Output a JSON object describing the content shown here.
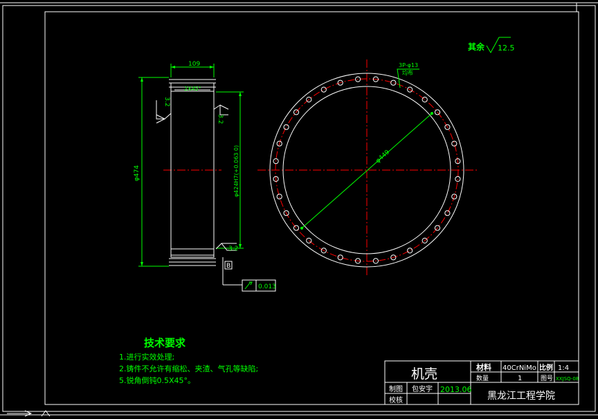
{
  "roughness": {
    "label": "其余",
    "value": "12.5"
  },
  "side_view": {
    "width_dim": "109",
    "chamfer_note": "2X45°",
    "outer_diameter": "φ474",
    "inner_diameter": "φ424H7(+0.063 0)",
    "roughness_left": "3.2",
    "roughness_right": "3.2",
    "roughness_bottom": "3.2",
    "datum": "B",
    "runout_tolerance": "0.013"
  },
  "front_view": {
    "hole_note": "3P-φ13",
    "hole_note_sub": "均布",
    "pitch_diameter": "φ449",
    "hole_count": 32
  },
  "tech_requirements": {
    "title": "技术要求",
    "items": [
      "1.进行实效处理;",
      "2.铸件不允许有缩松、夹渣、气孔等缺陷;",
      "5.锐角倒钝0.5X45°。"
    ]
  },
  "title_block": {
    "part_name": "机壳",
    "material_label": "材料",
    "material": "40CrNiMo",
    "scale_label": "比例",
    "scale": "1:4",
    "qty_label": "数量",
    "qty": "1",
    "drawing_no_label": "图号",
    "drawing_no": "XXJSQ-08",
    "drawn_by_label": "制图",
    "drawn_by": "包安宇",
    "date": "2013.06",
    "checked_label": "校核",
    "school": "黑龙江工程学院"
  },
  "colors": {
    "line": "#ffffff",
    "dimension": "#00ff00",
    "centerline": "#ff0000",
    "note_text": "#00ff00"
  }
}
